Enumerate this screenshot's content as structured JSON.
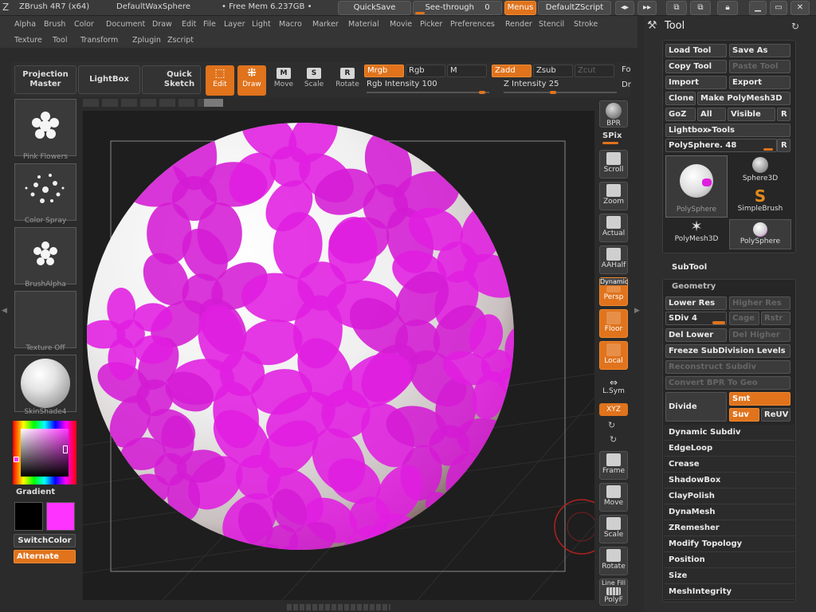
{
  "titlebar": {
    "app": "ZBrush 4R7 (x64)",
    "doc": "DefaultWaxSphere",
    "mem": "• Free Mem 6.237GB •",
    "quicksave": "QuickSave",
    "seethrough": "See-through",
    "seethrough_value": "0",
    "menus": "Menus",
    "script": "DefaultZScript"
  },
  "menus": {
    "row1": [
      "Alpha",
      "Brush",
      "Color",
      "Document",
      "Draw",
      "Edit",
      "File",
      "Layer",
      "Light",
      "Macro",
      "Marker",
      "Material",
      "Movie",
      "Picker",
      "Preferences",
      "Render",
      "Stencil",
      "Stroke"
    ],
    "row2": [
      "Texture",
      "Tool",
      "Transform",
      "Zplugin",
      "Zscript"
    ]
  },
  "shelf": {
    "projection_master": "Projection Master",
    "lightbox": "LightBox",
    "quick_sketch": "Quick Sketch",
    "edit": "Edit",
    "draw": "Draw",
    "move": "Move",
    "scale": "Scale",
    "rotate": "Rotate",
    "mrgb": "Mrgb",
    "rgb": "Rgb",
    "m": "M",
    "zadd": "Zadd",
    "zsub": "Zsub",
    "zcut": "Zcut",
    "fo": "Fo",
    "dr": "Dr",
    "rgb_intensity_label": "Rgb Intensity",
    "rgb_intensity": "100",
    "z_intensity_label": "Z Intensity",
    "z_intensity": "25"
  },
  "left": {
    "alpha": "Pink Flowers",
    "stroke": "Color Spray",
    "brush_alpha": "BrushAlpha",
    "texture": "Texture Off",
    "material": "SkinShade4",
    "gradient": "Gradient",
    "switchcolor": "SwitchColor",
    "alternate": "Alternate",
    "main_color": "#000000",
    "secondary_color": "#ff33ff"
  },
  "rightshelf": {
    "bpr": "BPR",
    "spix": "SPix",
    "scroll": "Scroll",
    "zoom": "Zoom",
    "actual": "Actual",
    "aahalf": "AAHalf",
    "dynamic": "Dynamic",
    "persp": "Persp",
    "floor": "Floor",
    "local": "Local",
    "lsym": "L.Sym",
    "xyz": "XYZ",
    "frame": "Frame",
    "move": "Move",
    "scale": "Scale",
    "rotate": "Rotate",
    "linefill": "Line Fill",
    "polyf": "PolyF"
  },
  "tool": {
    "title": "Tool",
    "load_tool": "Load Tool",
    "save_as": "Save As",
    "copy_tool": "Copy Tool",
    "paste_tool": "Paste Tool",
    "import": "Import",
    "export": "Export",
    "clone": "Clone",
    "make_polymesh": "Make PolyMesh3D",
    "goz": "GoZ",
    "all": "All",
    "visible": "Visible",
    "r": "R",
    "lightbox_tools": "Lightbox▸Tools",
    "polysphere_label": "PolySphere.",
    "polysphere_value": "48",
    "thumbs": [
      "PolySphere",
      "Sphere3D",
      "SimpleBrush",
      "PolyMesh3D",
      "PolySphere"
    ]
  },
  "subtool": "SubTool",
  "geometry": {
    "title": "Geometry",
    "lower_res": "Lower Res",
    "higher_res": "Higher Res",
    "sdiv_label": "SDiv",
    "sdiv_value": "4",
    "cage": "Cage",
    "rstr": "Rstr",
    "del_lower": "Del Lower",
    "del_higher": "Del Higher",
    "freeze": "Freeze SubDivision Levels",
    "reconstruct": "Reconstruct Subdiv",
    "convert_bpr": "Convert BPR To Geo",
    "divide": "Divide",
    "smt": "Smt",
    "suv": "Suv",
    "reuv": "ReUV"
  },
  "sections": [
    "Dynamic Subdiv",
    "EdgeLoop",
    "Crease",
    "ShadowBox",
    "ClayPolish",
    "DynaMesh",
    "ZRemesher",
    "Modify Topology",
    "Position",
    "Size",
    "MeshIntegrity"
  ],
  "colors": {
    "accent": "#e0731c",
    "paint": "#e01ee0"
  }
}
